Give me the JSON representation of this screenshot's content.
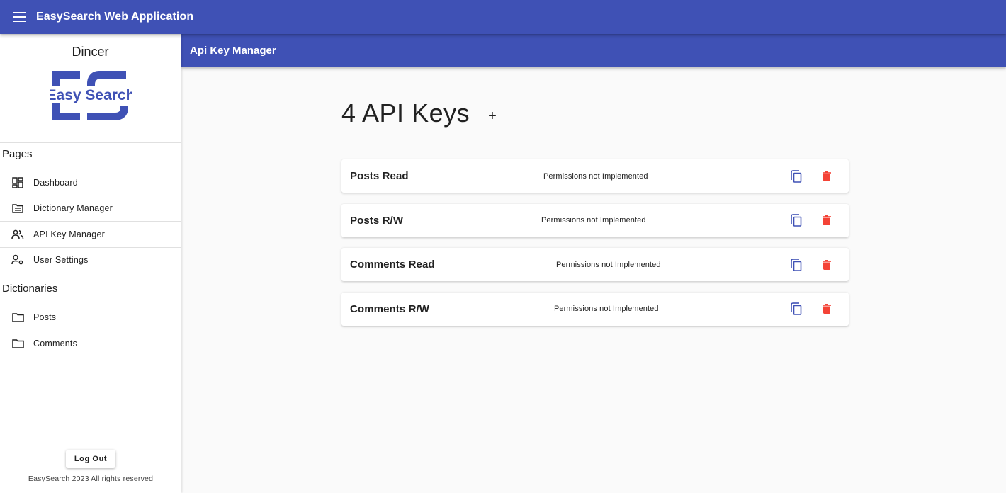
{
  "app": {
    "title": "EasySearch Web Application"
  },
  "header": {
    "menu_icon": "menu-icon"
  },
  "sidebar": {
    "username": "Dincer",
    "logo_text": "Easy Search",
    "pages_title": "Pages",
    "pages": [
      {
        "label": "Dashboard",
        "icon": "dashboard-icon"
      },
      {
        "label": "Dictionary Manager",
        "icon": "folder-list-icon"
      },
      {
        "label": "API Key Manager",
        "icon": "people-icon"
      },
      {
        "label": "User Settings",
        "icon": "person-settings-icon"
      }
    ],
    "dictionaries_title": "Dictionaries",
    "dictionaries": [
      {
        "label": "Posts",
        "icon": "folder-icon"
      },
      {
        "label": "Comments",
        "icon": "folder-icon"
      }
    ],
    "logout_label": "Log Out",
    "copyright": "EasySearch 2023 All rights reserved"
  },
  "subheader": {
    "title": "Api Key Manager"
  },
  "main": {
    "count_label": "4 API Keys",
    "add_label": "+",
    "keys": [
      {
        "name": "Posts Read",
        "permissions": "Permissions not Implemented"
      },
      {
        "name": "Posts R/W",
        "permissions": "Permissions not Implemented"
      },
      {
        "name": "Comments Read",
        "permissions": "Permissions not Implemented"
      },
      {
        "name": "Comments R/W",
        "permissions": "Permissions not Implemented"
      }
    ]
  },
  "colors": {
    "primary": "#3f51b5",
    "delete": "#f44336",
    "copy": "#3f51b5"
  }
}
